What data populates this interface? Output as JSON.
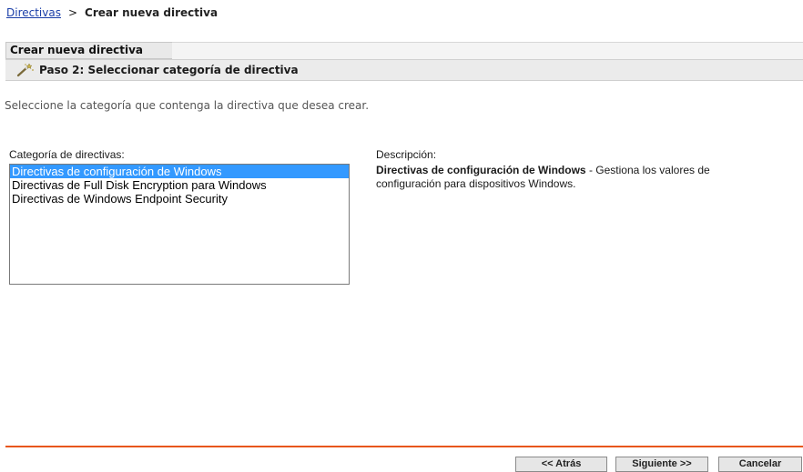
{
  "breadcrumb": {
    "link": "Directivas",
    "separator": ">",
    "current": "Crear nueva directiva"
  },
  "tab": {
    "label": "Crear nueva directiva"
  },
  "step": {
    "icon": "magic-wand-icon",
    "label": "Paso 2: Seleccionar categoría de directiva"
  },
  "instruction": "Seleccione la categoría que contenga la directiva que desea crear.",
  "category": {
    "label": "Categoría de directivas:",
    "options": [
      "Directivas de configuración de Windows",
      "Directivas de Full Disk Encryption para Windows",
      "Directivas de Windows Endpoint Security"
    ],
    "selected_index": 0
  },
  "description": {
    "label": "Descripción:",
    "title": "Directivas de configuración de Windows",
    "text": " - Gestiona los valores de configuración para dispositivos Windows."
  },
  "buttons": {
    "back": "<< Atrás",
    "next": "Siguiente >>",
    "cancel": "Cancelar"
  },
  "colors": {
    "link": "#1a3ea8",
    "selection": "#3399ff",
    "accent_rule": "#e8561b"
  }
}
